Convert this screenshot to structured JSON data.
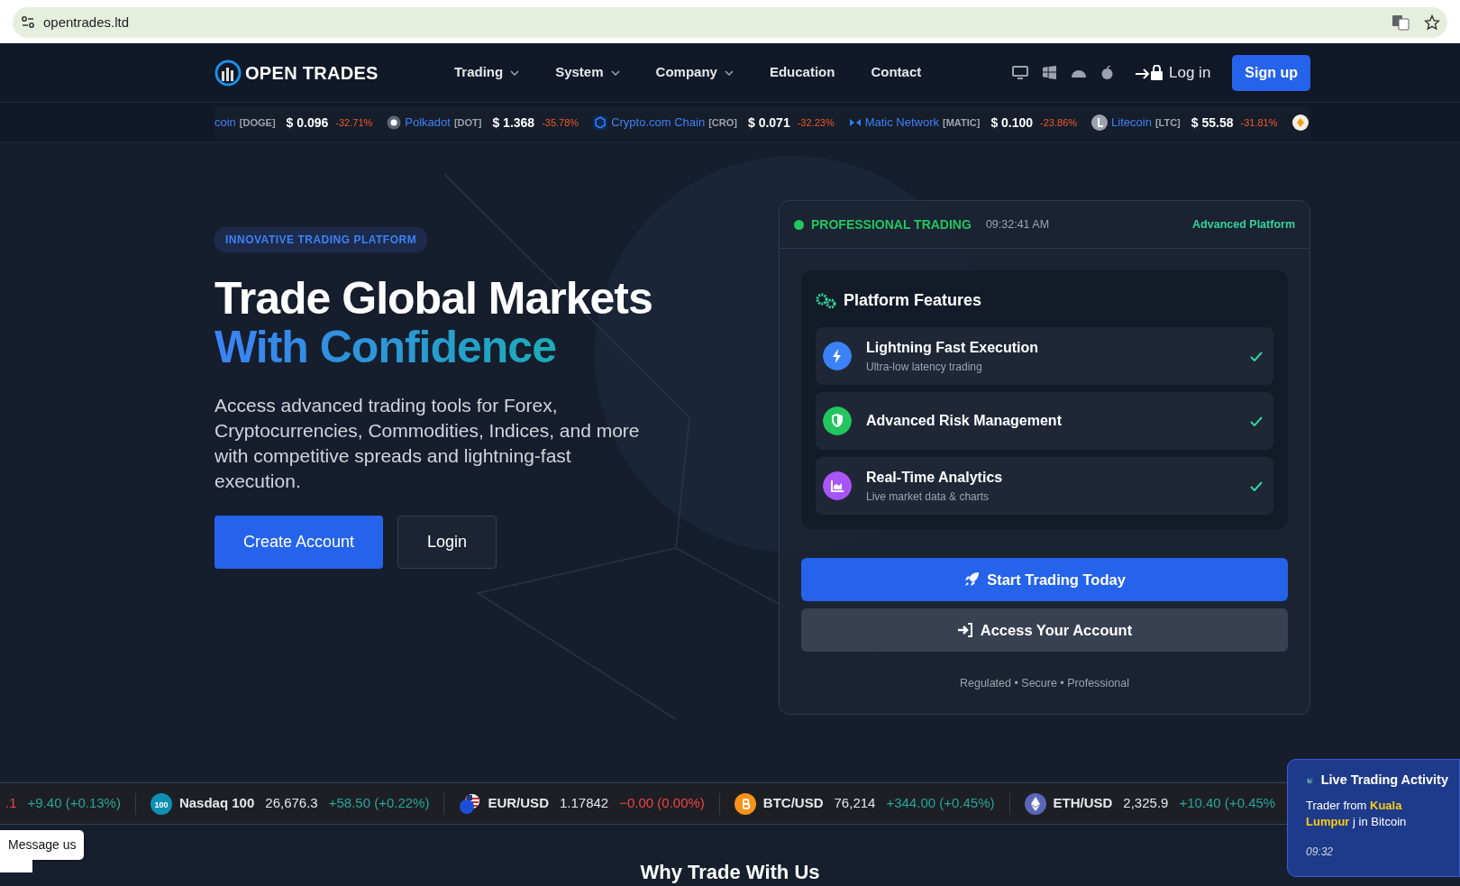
{
  "browser": {
    "url": "opentrades.ltd"
  },
  "nav": {
    "logo": "OPEN TRADES",
    "menu": [
      {
        "label": "Trading",
        "has_menu": true
      },
      {
        "label": "System",
        "has_menu": true
      },
      {
        "label": "Company",
        "has_menu": true
      },
      {
        "label": "Education",
        "has_menu": false
      },
      {
        "label": "Contact",
        "has_menu": false
      }
    ],
    "login": "Log in",
    "signup": "Sign up"
  },
  "crypto_ticker": [
    {
      "name": "coin",
      "symbol": "[DOGE]",
      "price": "$ 0.096",
      "change": "-32.71%",
      "kind": "none"
    },
    {
      "name": "Polkadot",
      "symbol": "[DOT]",
      "price": "$ 1.368",
      "change": "-35.78%",
      "kind": "dot"
    },
    {
      "name": "Crypto.com Chain",
      "symbol": "[CRO]",
      "price": "$ 0.071",
      "change": "-32.23%",
      "kind": "cro"
    },
    {
      "name": "Matic Network",
      "symbol": "[MATIC]",
      "price": "$ 0.100",
      "change": "-23.86%",
      "kind": "matic"
    },
    {
      "name": "Litecoin",
      "symbol": "[LTC]",
      "price": "$ 55.58",
      "change": "-31.81%",
      "kind": "ltc"
    }
  ],
  "hero": {
    "badge": "INNOVATIVE TRADING PLATFORM",
    "title_line1": "Trade Global Markets",
    "title_line2": "With Confidence",
    "description": "Access advanced trading tools for Forex, Cryptocurrencies, Commodities, Indices, and more with competitive spreads and lightning-fast execution.",
    "buttons": [
      {
        "label": "Create Account",
        "kind": "primary"
      },
      {
        "label": "Login",
        "kind": "outline"
      }
    ]
  },
  "panel": {
    "status": "PROFESSIONAL TRADING",
    "time": "09:32:41 AM",
    "tag": "Advanced Platform",
    "features_title": "Platform Features",
    "features": [
      {
        "title": "Lightning Fast Execution",
        "subtitle": "Ultra-low latency trading",
        "checked": true,
        "kind": "bolt",
        "color": "#3b82f6"
      },
      {
        "title": "Advanced Risk Management",
        "checked": true,
        "kind": "shield",
        "color": "#22c55e"
      },
      {
        "title": "Real-Time Analytics",
        "subtitle": "Live market data & charts",
        "checked": true,
        "kind": "chart",
        "color": "#a855f7"
      }
    ],
    "buttons": [
      {
        "label": "Start Trading Today",
        "kind": "primary"
      },
      {
        "label": "Access Your Account",
        "kind": "secondary"
      }
    ],
    "footer": "Regulated • Secure • Professional"
  },
  "market_ticker": [
    {
      "price": ".1",
      "change": "+9.40 (+0.13%)",
      "color": "#26a69a",
      "kind": "partial"
    },
    {
      "name": "Nasdaq 100",
      "icon_text": "100",
      "price": "26,676.3",
      "change": "+58.50 (+0.22%)",
      "color": "#26a69a",
      "kind": "index"
    },
    {
      "name": "EUR/USD",
      "price": "1.17842",
      "change": "−0.00 (0.00%)",
      "color": "#ef4444",
      "kind": "flags"
    },
    {
      "name": "BTC/USD",
      "price": "76,214",
      "change": "+344.00 (+0.45%)",
      "color": "#26a69a",
      "kind": "btc"
    },
    {
      "name": "ETH/USD",
      "price": "2,325.9",
      "change": "+10.40 (+0.45%",
      "color": "#26a69a",
      "kind": "eth"
    }
  ],
  "chat": {
    "label": "Message us"
  },
  "activity": {
    "title": "Live Trading Activity",
    "message": "Trader from **Kuala Lumpur** j in Bitcoin",
    "time": "09:32"
  },
  "next_section": {
    "title": "Why Trade With Us"
  }
}
